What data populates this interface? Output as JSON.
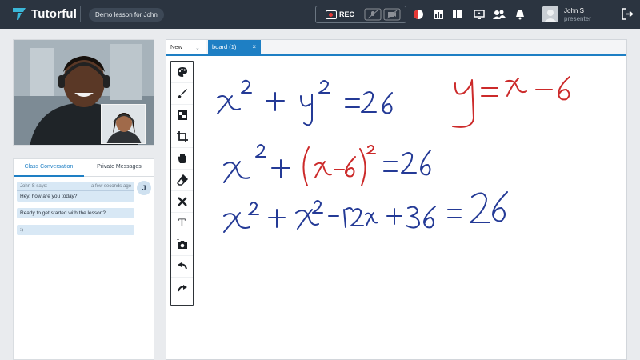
{
  "topbar": {
    "brand": "Tutorful",
    "lesson_title": "Demo lesson for John",
    "rec_label": "REC",
    "user": {
      "name": "John S",
      "role": "presenter"
    }
  },
  "chat": {
    "tabs": [
      "Class Conversation",
      "Private Messages"
    ],
    "messages": [
      {
        "author": "John S says:",
        "time": "a few seconds ago",
        "text": "Hey, how are you today?"
      },
      {
        "text": "Ready to get started with the lesson?"
      },
      {
        "text": ":)"
      }
    ],
    "avatar_initial": "J"
  },
  "board": {
    "tabs": {
      "new_label": "New",
      "board_label": "board (1)",
      "close_glyph": "×"
    },
    "tools": [
      "palette-icon",
      "brush-icon",
      "fill-icon",
      "crop-icon",
      "hand-icon",
      "eraser-icon",
      "clear-icon",
      "text-icon",
      "camera-icon",
      "undo-icon",
      "redo-icon"
    ],
    "text_tool_glyph": "T",
    "handwriting": {
      "line1": "x² + y² = 26",
      "line1_right": "y = x − 6",
      "line2": "x² + (x−6)² = 26",
      "line3": "x² + x² − 12x + 36 = 26"
    },
    "ink_colors": {
      "blue": "#243a96",
      "red": "#cc2a2a"
    }
  },
  "colors": {
    "topbar_bg": "#2b3440",
    "accent": "#1e7fc4",
    "rec_dot": "#e53935"
  }
}
